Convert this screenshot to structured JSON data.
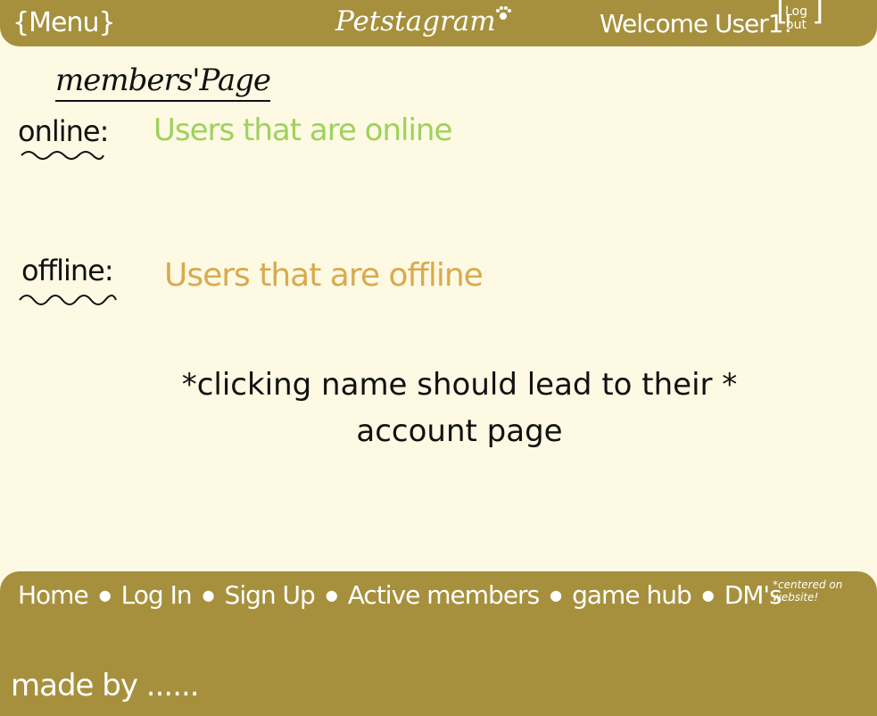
{
  "header": {
    "menu_label": "{Menu}",
    "brand": "Petstagram",
    "welcome": "Welcome User1!",
    "logout_line1": "Log",
    "logout_line2": "out"
  },
  "page": {
    "title": "members'Page",
    "online_label": "online:",
    "online_value": "Users that are online",
    "offline_label": "offline:",
    "offline_value": "Users that are offline",
    "note_line1": "*clicking name should lead to their *",
    "note_line2": "account page"
  },
  "footer": {
    "nav": [
      "Home",
      "Log In",
      "Sign Up",
      "Active members",
      "game hub",
      "DM's"
    ],
    "note": "*centered on website!",
    "made_by": "made by ......"
  },
  "colors": {
    "bar": "#a6903d",
    "background": "#fdf9e3",
    "online": "#9ed25b",
    "offline": "#d8aa4e"
  }
}
